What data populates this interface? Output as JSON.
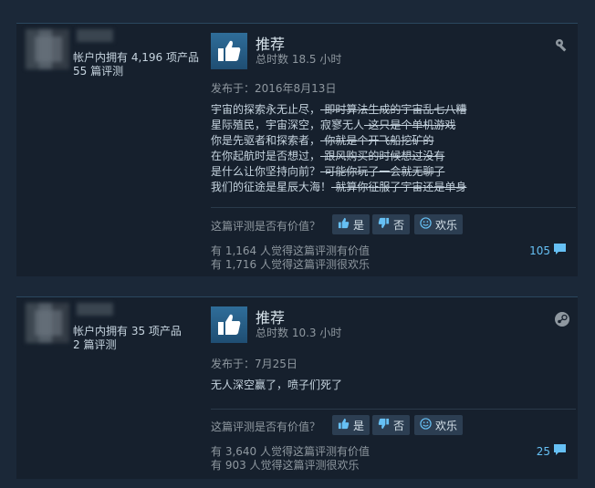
{
  "reviews": [
    {
      "owned": "帐户内拥有 4,196 项产品",
      "review_count": "55 篇评测",
      "recommendation": "推荐",
      "hours": "总时数 18.5 小时",
      "posted": "发布于：2016年8月13日",
      "lines": [
        {
          "normal": "宇宙的探索永无止尽，",
          "struck": "-即时算法生成的宇宙乱七八糟"
        },
        {
          "normal": "星际殖民，宇宙深空，寂寥无人",
          "struck": "-这只是个单机游戏"
        },
        {
          "normal": "你是先驱者和探索者，",
          "struck": "-你就是个开飞船挖矿的"
        },
        {
          "normal": "在你起航时是否想过，",
          "struck": "-跟风购买的时候想过没有"
        },
        {
          "normal": "是什么让你坚持向前？",
          "struck": "-可能你玩了一会就无聊了"
        },
        {
          "normal": "我们的征途是星辰大海！",
          "struck": "-就算你征服了宇宙还是单身"
        }
      ],
      "helpful_question": "这篇评测是否有价值？",
      "yes_label": "是",
      "no_label": "否",
      "funny_label": "欢乐",
      "helpful_stat": "有 1,164 人觉得这篇评测有价值",
      "funny_stat": "有 1,716 人觉得这篇评测很欢乐",
      "comment_count": "105",
      "corner_icon": "settings-icon"
    },
    {
      "owned": "帐户内拥有 35 项产品",
      "review_count": "2 篇评测",
      "recommendation": "推荐",
      "hours": "总时数 10.3 小时",
      "posted": "发布于：7月25日",
      "lines": [
        {
          "normal": "无人深空赢了，喷子们死了",
          "struck": ""
        }
      ],
      "helpful_question": "这篇评测是否有价值？",
      "yes_label": "是",
      "no_label": "否",
      "funny_label": "欢乐",
      "helpful_stat": "有 3,640 人觉得这篇评测有价值",
      "funny_stat": "有 903 人觉得这篇评测很欢乐",
      "comment_count": "25",
      "corner_icon": "steam-icon"
    }
  ]
}
